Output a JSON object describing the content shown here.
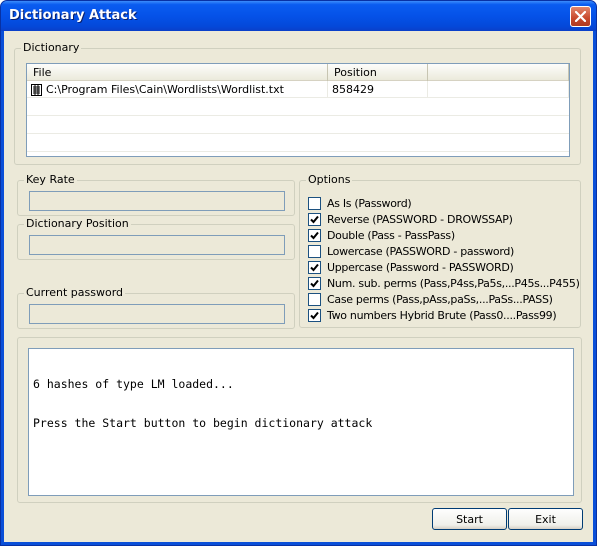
{
  "window": {
    "title": "Dictionary Attack"
  },
  "dictionary": {
    "group_label": "Dictionary",
    "columns": [
      "File",
      "Position",
      ""
    ],
    "rows": [
      {
        "file": "C:\\Program Files\\Cain\\Wordlists\\Wordlist.txt",
        "position": "858429"
      }
    ]
  },
  "key_rate": {
    "label": "Key Rate",
    "value": ""
  },
  "dictionary_position": {
    "label": "Dictionary Position",
    "value": ""
  },
  "current_password": {
    "label": "Current password",
    "value": ""
  },
  "options": {
    "group_label": "Options",
    "items": [
      {
        "label": "As Is (Password)",
        "checked": false
      },
      {
        "label": "Reverse (PASSWORD - DROWSSAP)",
        "checked": true
      },
      {
        "label": "Double (Pass - PassPass)",
        "checked": true
      },
      {
        "label": "Lowercase (PASSWORD - password)",
        "checked": false
      },
      {
        "label": "Uppercase (Password - PASSWORD)",
        "checked": true
      },
      {
        "label": "Num. sub. perms (Pass,P4ss,Pa5s,...P45s...P455)",
        "checked": true
      },
      {
        "label": "Case perms (Pass,pAss,paSs,...PaSs...PASS)",
        "checked": false
      },
      {
        "label": "Two numbers Hybrid Brute (Pass0....Pass99)",
        "checked": true
      }
    ]
  },
  "console": {
    "lines": [
      "6 hashes of type LM loaded...",
      "Press the Start button to begin dictionary attack"
    ]
  },
  "buttons": {
    "start": "Start",
    "exit": "Exit"
  },
  "colors": {
    "title_bar": "#0552e8",
    "face": "#ece9d8",
    "field_border": "#7f9db9"
  }
}
